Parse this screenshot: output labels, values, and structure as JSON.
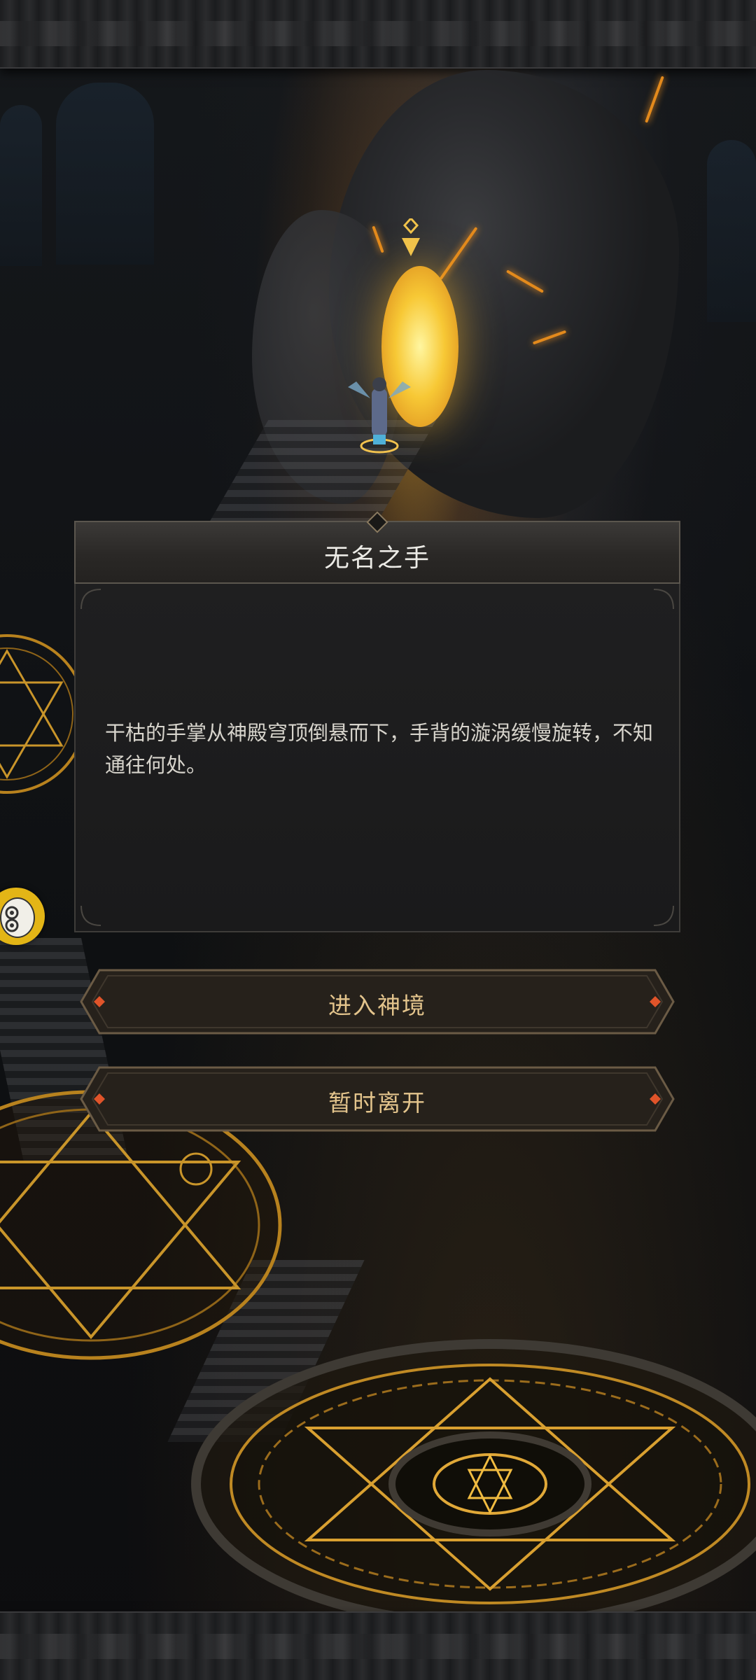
{
  "dialog": {
    "title": "无名之手",
    "description": "干枯的手掌从神殿穹顶倒悬而下，手背的漩涡缓慢旋转，不知通往何处。"
  },
  "actions": {
    "enter": "进入神境",
    "leave": "暂时离开"
  },
  "icons": {
    "waypoint": "waypoint-marker-icon",
    "side": "spirit-mask-icon"
  },
  "colors": {
    "accent_gold": "#e3c48c",
    "lava": "#e38a1c",
    "gem": "#e0542a"
  }
}
